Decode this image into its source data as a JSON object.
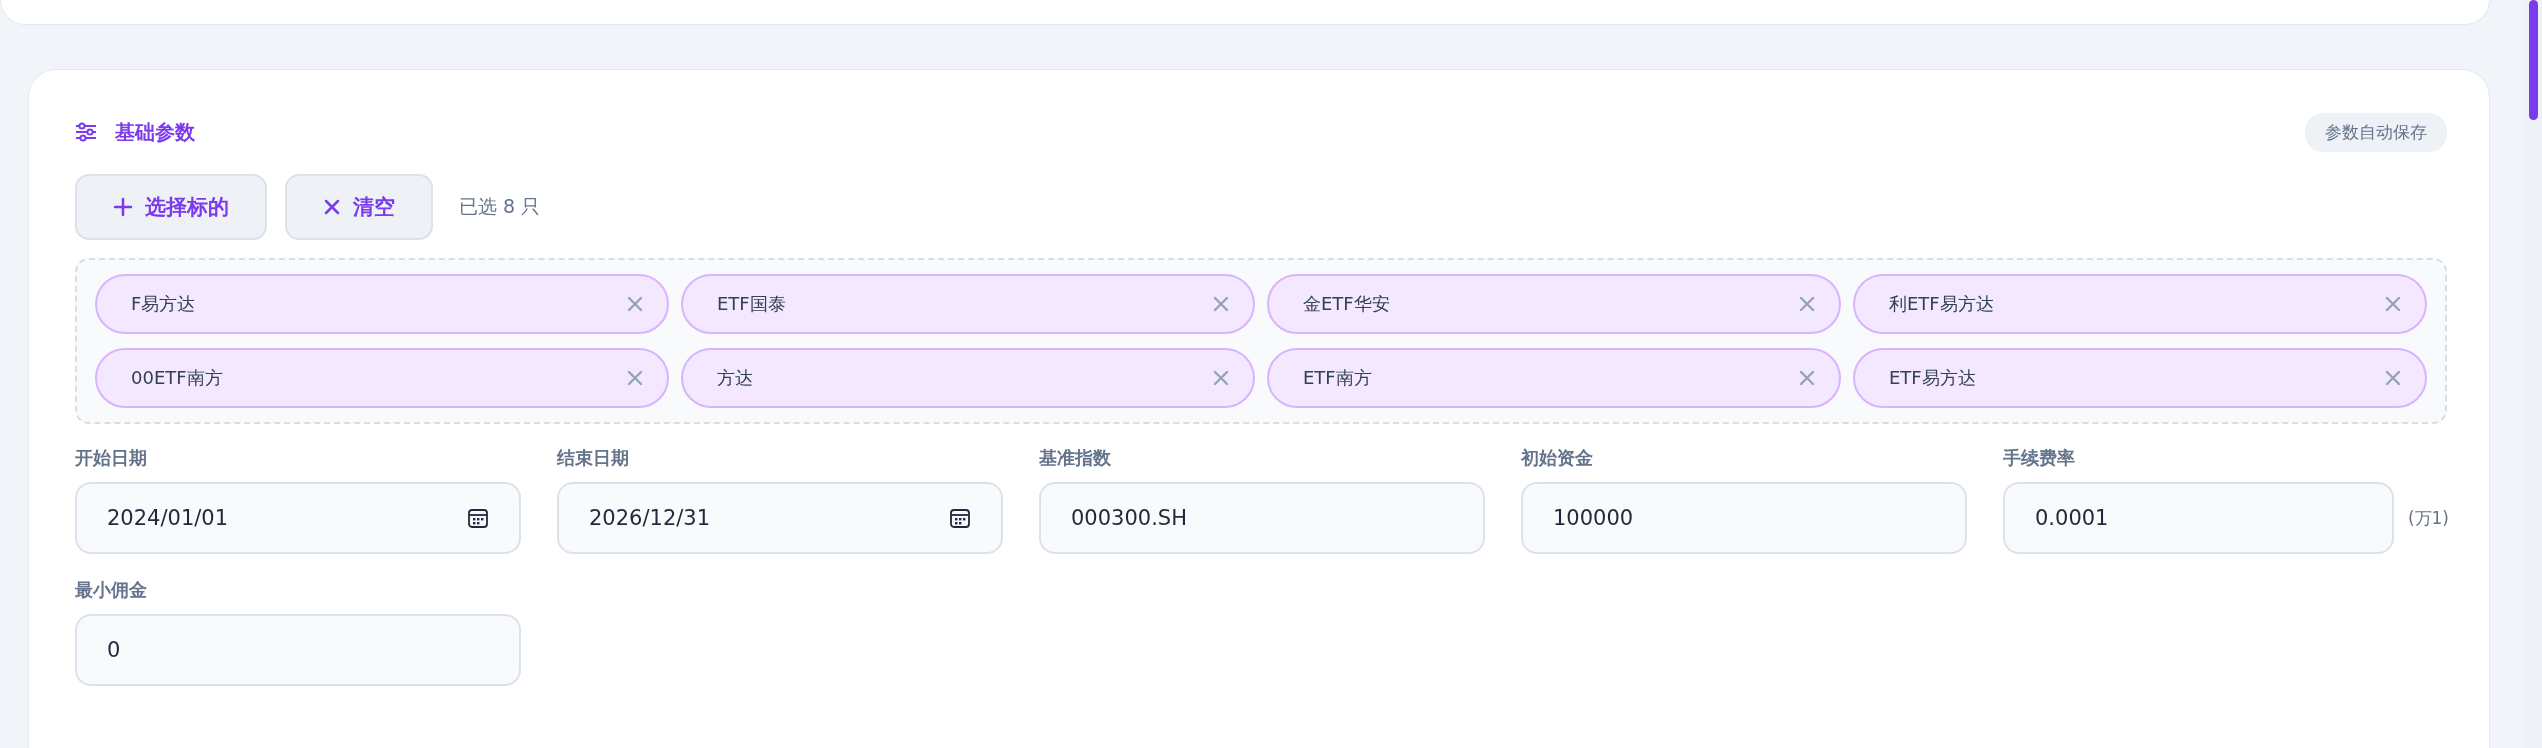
{
  "section": {
    "title": "基础参数",
    "badge": "参数自动保存"
  },
  "actions": [
    {
      "kind": "add",
      "label": "选择标的"
    },
    {
      "kind": "clear",
      "label": "清空"
    }
  ],
  "selected_count": "已选 8 只",
  "chips": [
    {
      "label": "F易方达"
    },
    {
      "label": "ETF国泰"
    },
    {
      "label": "金ETF华安"
    },
    {
      "label": "利ETF易方达"
    },
    {
      "label": "00ETF南方"
    },
    {
      "label": "方达"
    },
    {
      "label": "ETF南方"
    },
    {
      "label": "ETF易方达"
    }
  ],
  "fields": [
    {
      "label": "开始日期",
      "value": "2024/01/01",
      "kind": "date"
    },
    {
      "label": "结束日期",
      "value": "2026/12/31",
      "kind": "date"
    },
    {
      "label": "基准指数",
      "value": "000300.SH",
      "kind": "text"
    },
    {
      "label": "初始资金",
      "value": "100000",
      "kind": "text"
    },
    {
      "label": "手续费率",
      "value": "0.0001",
      "kind": "text",
      "suffix": "(万1)"
    },
    {
      "label": "最小佣金",
      "value": "0",
      "kind": "text"
    }
  ]
}
